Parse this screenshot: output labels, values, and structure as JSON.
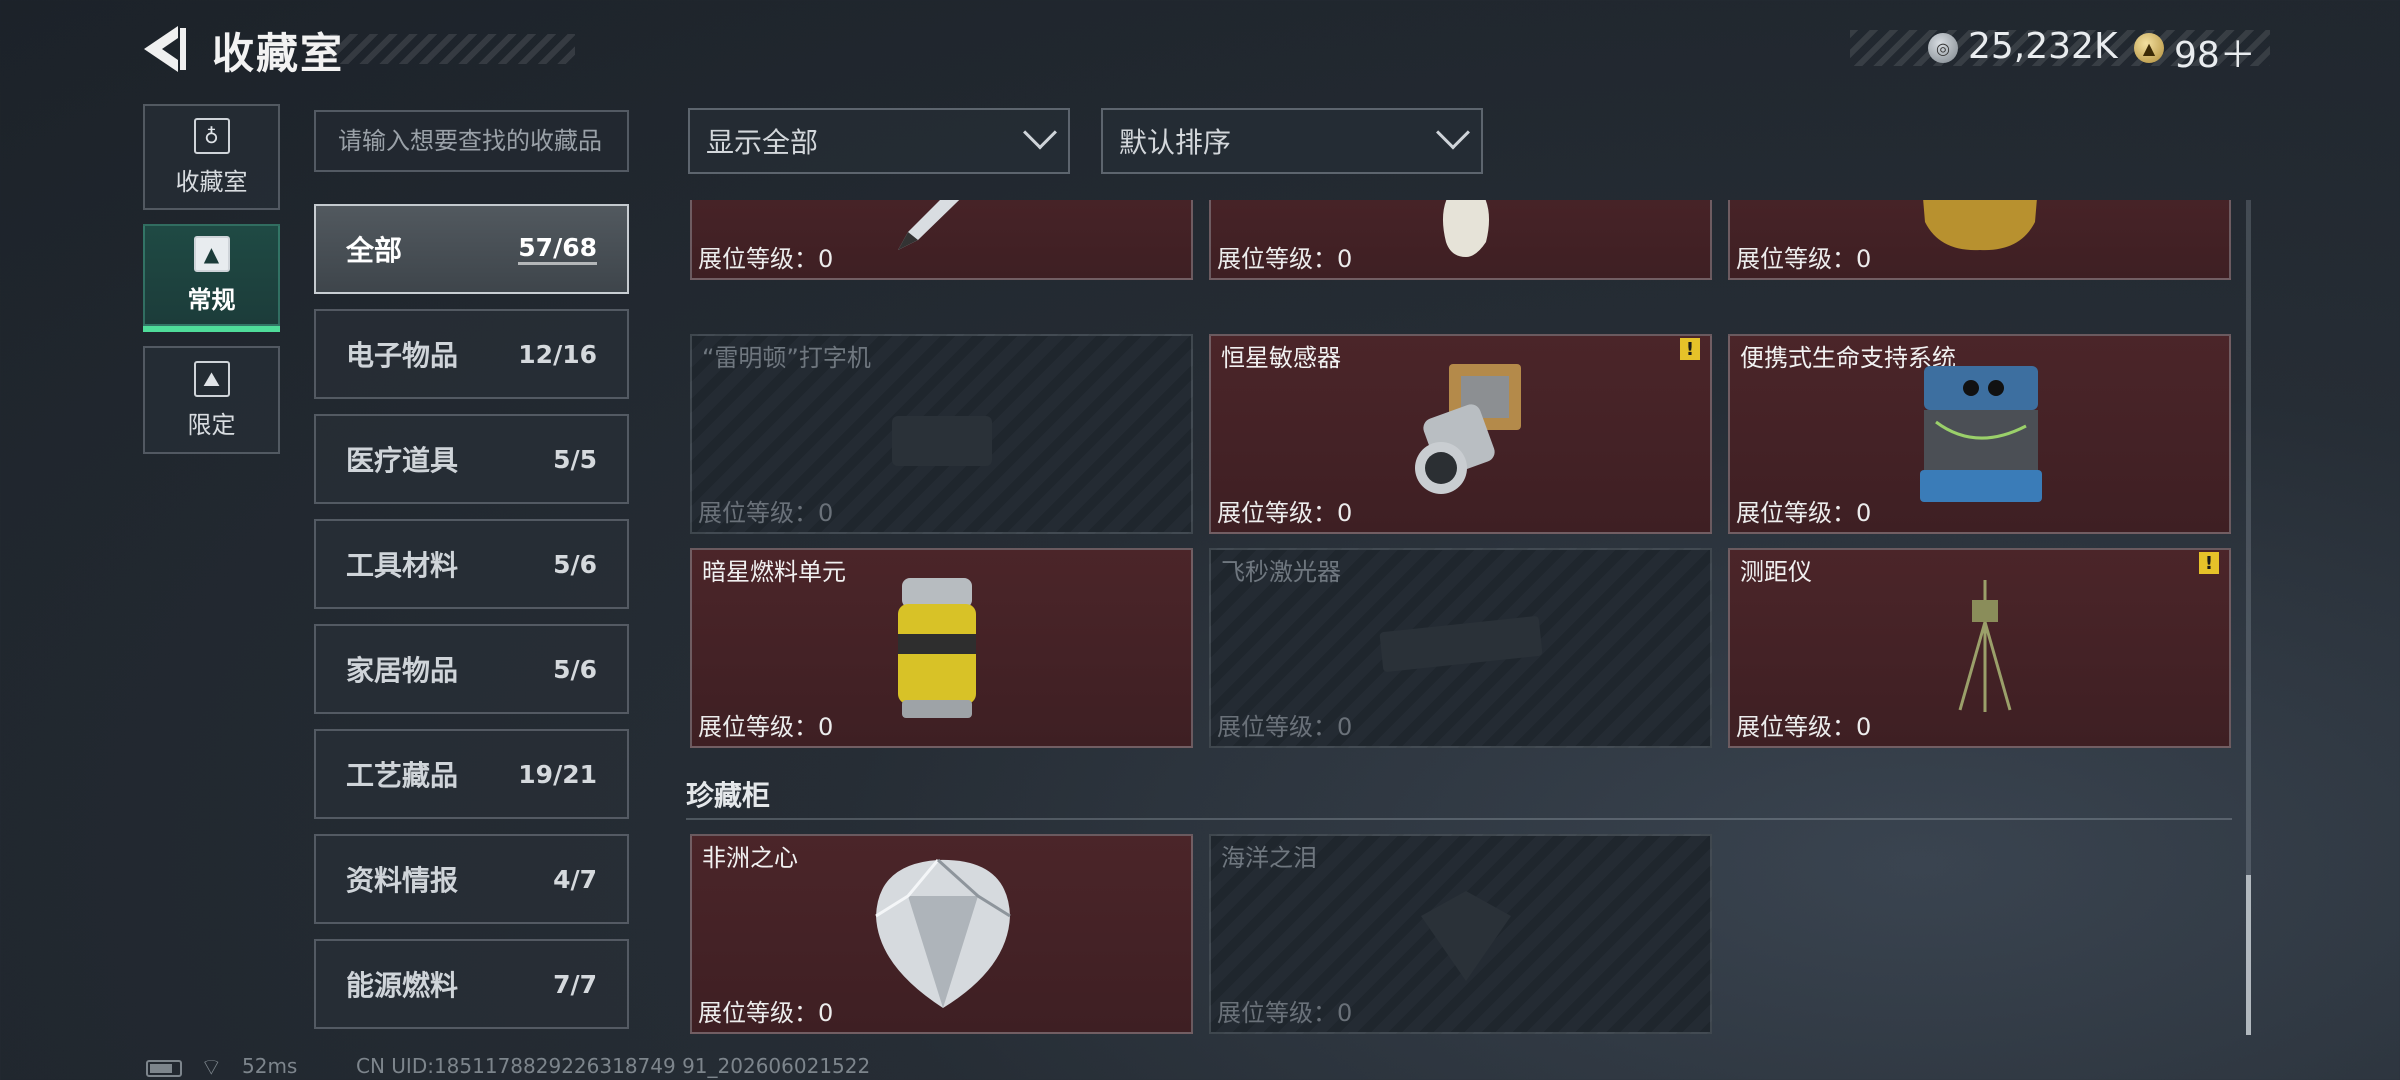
{
  "header": {
    "title": "收藏室",
    "currency1_value": "25,232K",
    "currency2_value": "98＋",
    "currency1_icon": "silver-coin-icon",
    "currency2_icon": "gold-token-icon"
  },
  "nav": [
    {
      "label": "收藏室",
      "icon": "collection-room-icon",
      "active": false
    },
    {
      "label": "常规",
      "icon": "regular-icon",
      "active": true
    },
    {
      "label": "限定",
      "icon": "limited-icon",
      "active": false
    }
  ],
  "search": {
    "placeholder": "请输入想要查找的收藏品"
  },
  "categories": [
    {
      "name": "全部",
      "count": "57/68",
      "active": true
    },
    {
      "name": "电子物品",
      "count": "12/16"
    },
    {
      "name": "医疗道具",
      "count": "5/5"
    },
    {
      "name": "工具材料",
      "count": "5/6"
    },
    {
      "name": "家居物品",
      "count": "5/6"
    },
    {
      "name": "工艺藏品",
      "count": "19/21"
    },
    {
      "name": "资料情报",
      "count": "4/7"
    },
    {
      "name": "能源燃料",
      "count": "7/7"
    }
  ],
  "filters": {
    "display": "显示全部",
    "sort": "默认排序"
  },
  "cards_row0": [
    {
      "name": "",
      "level": "展位等级：0",
      "owned": true,
      "icon": "pen-icon"
    },
    {
      "name": "",
      "level": "展位等级：0",
      "owned": true,
      "icon": "vase-icon"
    },
    {
      "name": "",
      "level": "展位等级：0",
      "owned": true,
      "icon": "golden-statue-icon"
    }
  ],
  "cards_row1": [
    {
      "name": "“雷明顿”打字机",
      "level": "展位等级：0",
      "owned": false,
      "icon": "typewriter-icon"
    },
    {
      "name": "恒星敏感器",
      "level": "展位等级：0",
      "owned": true,
      "warn": true,
      "icon": "star-sensor-icon"
    },
    {
      "name": "便携式生命支持系统",
      "level": "展位等级：0",
      "owned": true,
      "icon": "life-support-icon"
    }
  ],
  "cards_row2": [
    {
      "name": "暗星燃料单元",
      "level": "展位等级：0",
      "owned": true,
      "icon": "fuel-canister-icon"
    },
    {
      "name": "飞秒激光器",
      "level": "展位等级：0",
      "owned": false,
      "icon": "laser-icon"
    },
    {
      "name": "测距仪",
      "level": "展位等级：0",
      "owned": true,
      "warn": true,
      "icon": "rangefinder-icon"
    }
  ],
  "section": {
    "title": "珍藏柜"
  },
  "cards_row3": [
    {
      "name": "非洲之心",
      "level": "展位等级：0",
      "owned": true,
      "icon": "diamond-icon"
    },
    {
      "name": "海洋之泪",
      "level": "展位等级：0",
      "owned": false,
      "icon": "gem-icon"
    }
  ],
  "status": {
    "ping": "52ms",
    "uid": "CN UID:1851178829226318749 91_202606021522"
  },
  "colors": {
    "owned_card": "#4b2529",
    "active_nav": "#1f4a44",
    "active_indicator": "#4fdc9a",
    "warning": "#e6c229"
  }
}
